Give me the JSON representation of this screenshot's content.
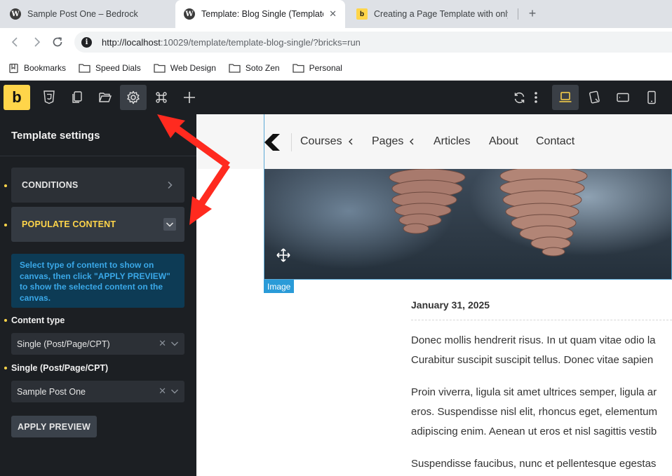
{
  "browser": {
    "tabs": [
      {
        "title": "Sample Post One – Bedrock",
        "favicon": "wordpress-icon",
        "active": false
      },
      {
        "title": "Template: Blog Single (Template)",
        "favicon": "wordpress-icon",
        "active": true
      },
      {
        "title": "Creating a Page Template with only W",
        "favicon": "bricks-icon",
        "active": false
      }
    ],
    "url_host": "http://localhost",
    "url_rest": ":10029/template/template-blog-single/?bricks=run",
    "bookmarks": [
      {
        "label": "Bookmarks",
        "icon": "bookmarks-icon"
      },
      {
        "label": "Speed Dials",
        "icon": "folder-icon"
      },
      {
        "label": "Web Design",
        "icon": "folder-icon"
      },
      {
        "label": "Soto Zen",
        "icon": "folder-icon"
      },
      {
        "label": "Personal",
        "icon": "folder-icon"
      }
    ]
  },
  "builder": {
    "logo": "b",
    "accent": "#ffd54a",
    "panel": {
      "title": "Template settings",
      "sections": [
        {
          "label": "CONDITIONS",
          "open": false
        },
        {
          "label": "POPULATE CONTENT",
          "open": true
        }
      ],
      "info": "Select type of content to show on canvas, then click \"APPLY PREVIEW\" to show the selected content on the canvas.",
      "content_type_label": "Content type",
      "content_type_value": "Single (Post/Page/CPT)",
      "single_label": "Single (Post/Page/CPT)",
      "single_value": "Sample Post One",
      "apply_label": "APPLY PREVIEW"
    }
  },
  "canvas": {
    "nav": [
      {
        "label": "Courses",
        "has_submenu": true
      },
      {
        "label": "Pages",
        "has_submenu": true
      },
      {
        "label": "Articles",
        "has_submenu": false
      },
      {
        "label": "About",
        "has_submenu": false
      },
      {
        "label": "Contact",
        "has_submenu": false
      }
    ],
    "image_tag": "Image",
    "post_date": "January 31, 2025",
    "paragraphs": [
      [
        "Donec mollis hendrerit risus. In ut quam vitae odio la",
        "Curabitur suscipit suscipit tellus. Donec vitae sapien"
      ],
      [
        "Proin viverra, ligula sit amet ultrices semper, ligula ar",
        "eros. Suspendisse nisl elit, rhoncus eget, elementum",
        "adipiscing enim. Aenean ut eros et nisl sagittis vestib"
      ],
      [
        "Suspendisse faucibus, nunc et pellentesque egestas"
      ]
    ]
  }
}
